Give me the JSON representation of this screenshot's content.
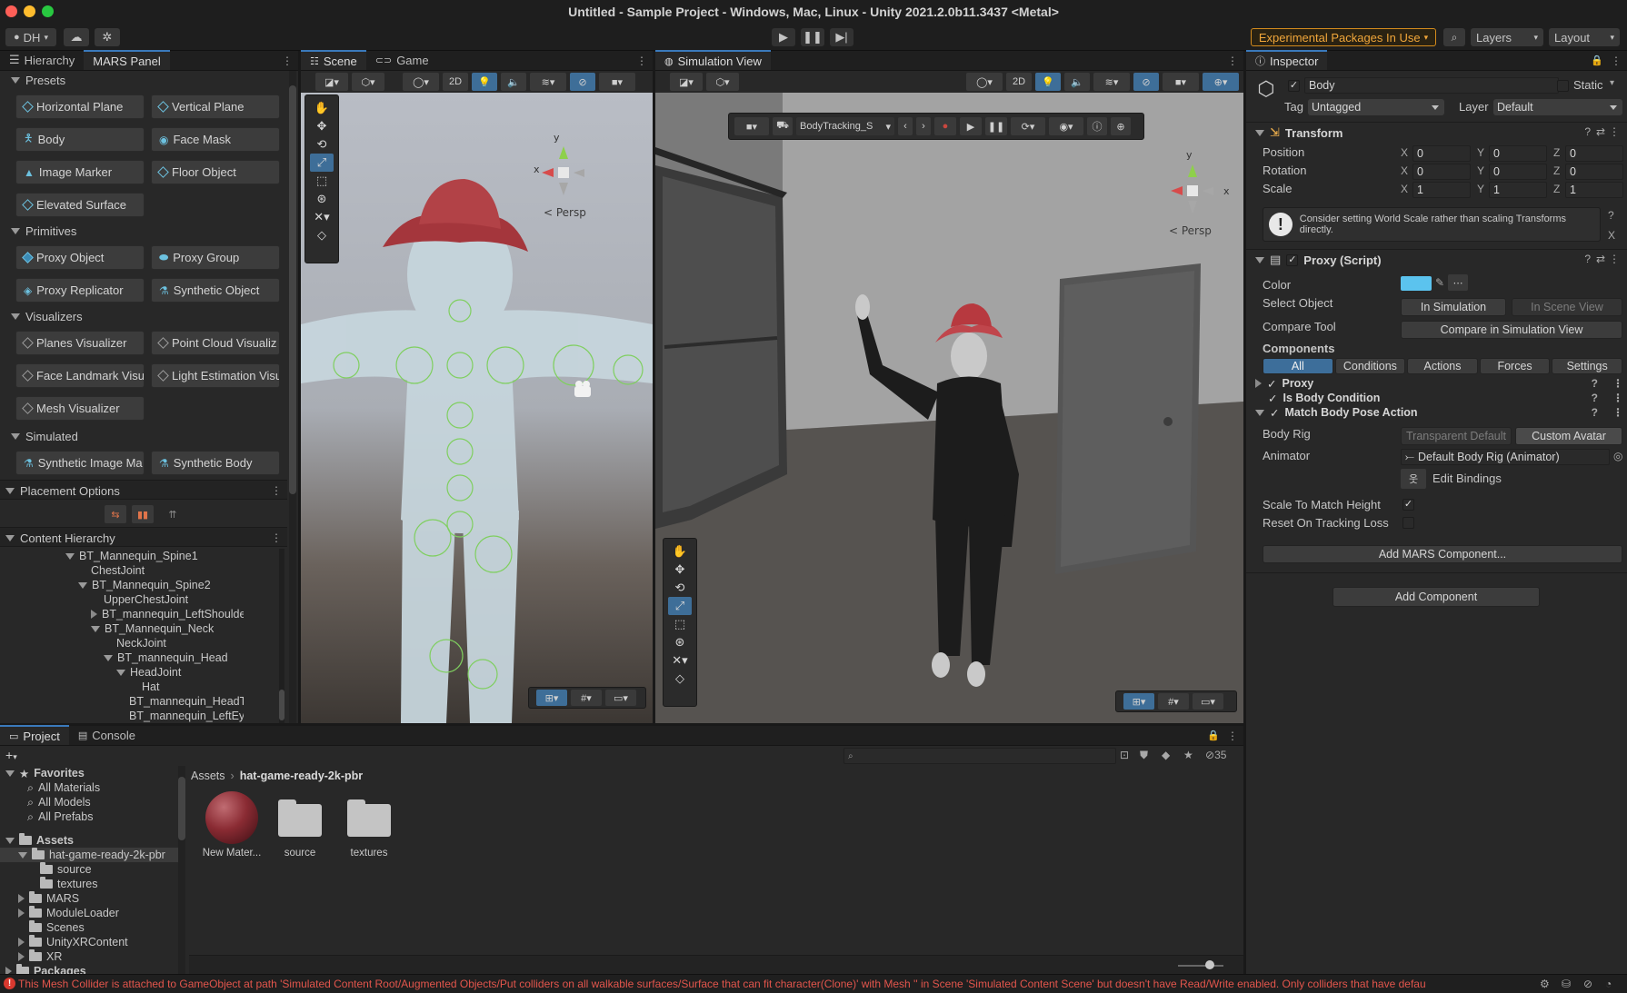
{
  "window": {
    "title": "Untitled - Sample Project - Windows, Mac, Linux - Unity 2021.2.0b11.3437 <Metal>"
  },
  "toolbar": {
    "account": "DH",
    "experimental": "Experimental Packages In Use",
    "layers": "Layers",
    "layout": "Layout"
  },
  "left": {
    "tabs": [
      "Hierarchy",
      "MARS Panel"
    ],
    "presets_label": "Presets",
    "presets": [
      "Horizontal Plane",
      "Vertical Plane",
      "Body",
      "Face Mask",
      "Image Marker",
      "Floor Object",
      "Elevated Surface"
    ],
    "primitives_label": "Primitives",
    "primitives": [
      "Proxy Object",
      "Proxy Group",
      "Proxy Replicator",
      "Synthetic Object"
    ],
    "visualizers_label": "Visualizers",
    "visualizers": [
      "Planes Visualizer",
      "Point Cloud Visualiz",
      "Face Landmark Visu",
      "Light Estimation Visu",
      "Mesh Visualizer"
    ],
    "simulated_label": "Simulated",
    "simulated": [
      "Synthetic Image Ma",
      "Synthetic Body"
    ],
    "placement_label": "Placement Options",
    "content_label": "Content Hierarchy",
    "tree": [
      "BT_Mannequin_Spine1",
      "ChestJoint",
      "BT_Mannequin_Spine2",
      "UpperChestJoint",
      "BT_mannequin_LeftShoulde",
      "BT_Mannequin_Neck",
      "NeckJoint",
      "BT_mannequin_Head",
      "HeadJoint",
      "Hat",
      "BT_mannequin_HeadT",
      "BT_mannequin_LeftEy"
    ]
  },
  "scene": {
    "tabs": [
      "Scene",
      "Game"
    ],
    "mode_2d": "2D",
    "persp": "< Persp",
    "axis_y": "y",
    "axis_x": "x"
  },
  "sim": {
    "tab": "Simulation View",
    "mode_2d": "2D",
    "persp": "< Persp",
    "session": "BodyTracking_S",
    "axis_y": "y",
    "axis_x": "x"
  },
  "inspector": {
    "tab": "Inspector",
    "object_name": "Body",
    "static": "Static",
    "tag_label": "Tag",
    "tag_value": "Untagged",
    "layer_label": "Layer",
    "layer_value": "Default",
    "transform": {
      "title": "Transform",
      "rows": [
        {
          "label": "Position",
          "x": "0",
          "y": "0",
          "z": "0"
        },
        {
          "label": "Rotation",
          "x": "0",
          "y": "0",
          "z": "0"
        },
        {
          "label": "Scale",
          "x": "1",
          "y": "1",
          "z": "1"
        }
      ],
      "warning": "Consider setting World Scale rather than scaling Transforms directly."
    },
    "proxy": {
      "title": "Proxy (Script)",
      "color_label": "Color",
      "color": "#5bc3ee",
      "select_label": "Select Object",
      "in_sim": "In Simulation",
      "in_scene": "In Scene View",
      "compare_label": "Compare Tool",
      "compare_btn": "Compare in Simulation View",
      "components_label": "Components",
      "filter_tabs": [
        "All",
        "Conditions",
        "Actions",
        "Forces",
        "Settings"
      ],
      "items": [
        "Proxy",
        "Is Body Condition",
        "Match Body Pose Action"
      ],
      "body_rig_label": "Body Rig",
      "transparent_default": "Transparent Default",
      "custom_avatar": "Custom Avatar",
      "animator_label": "Animator",
      "animator_value": "Default Body Rig (Animator)",
      "edit_bindings": "Edit Bindings",
      "scale_match": "Scale To Match Height",
      "reset_loss": "Reset On Tracking Loss",
      "add_mars": "Add MARS Component...",
      "add_component": "Add Component"
    }
  },
  "project": {
    "tabs": [
      "Project",
      "Console"
    ],
    "count": "35",
    "favorites_label": "Favorites",
    "favorites": [
      "All Materials",
      "All Models",
      "All Prefabs"
    ],
    "assets_label": "Assets",
    "assets_tree": [
      "hat-game-ready-2k-pbr",
      "source",
      "textures",
      "MARS",
      "ModuleLoader",
      "Scenes",
      "UnityXRContent",
      "XR"
    ],
    "packages_label": "Packages",
    "breadcrumb": [
      "Assets",
      "hat-game-ready-2k-pbr"
    ],
    "files": [
      "New Mater...",
      "source",
      "textures"
    ]
  },
  "status": {
    "message": "This Mesh Collider is attached to GameObject at path 'Simulated Content Root/Augmented Objects/Put colliders on all walkable surfaces/Surface that can fit character(Clone)' with Mesh '' in Scene 'Simulated Content Scene' but doesn't have Read/Write enabled. Only colliders that have defau"
  }
}
